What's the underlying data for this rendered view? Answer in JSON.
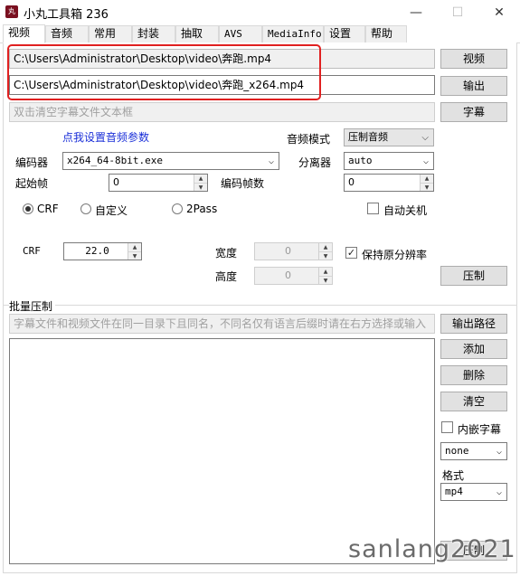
{
  "window": {
    "icon_text": "丸",
    "title": "小丸工具箱 236",
    "minimize_glyph": "—",
    "maximize_glyph": "☐",
    "close_glyph": "✕"
  },
  "tabs": [
    "视频",
    "音频",
    "常用",
    "封装",
    "抽取",
    "AVS",
    "MediaInfo",
    "设置",
    "帮助"
  ],
  "video": {
    "input_path": "C:\\Users\\Administrator\\Desktop\\video\\奔跑.mp4",
    "output_path": "C:\\Users\\Administrator\\Desktop\\video\\奔跑_x264.mp4",
    "subtitle_placeholder": "双击清空字幕文件文本框",
    "video_button": "视频",
    "output_button": "输出",
    "subtitle_button": "字幕",
    "audio_params_link": "点我设置音频参数",
    "audio_mode_label": "音频模式",
    "audio_mode_value": "压制音频",
    "encoder_label": "编码器",
    "encoder_value": "x264_64-8bit.exe",
    "demuxer_label": "分离器",
    "demuxer_value": "auto",
    "start_frame_label": "起始帧",
    "start_frame_value": "0",
    "encode_frames_label": "编码帧数",
    "encode_frames_value": "0",
    "mode_crf": "CRF",
    "mode_custom": "自定义",
    "mode_2pass": "2Pass",
    "auto_shutdown_label": "自动关机",
    "crf_label": "CRF",
    "crf_value": "22.0",
    "width_label": "宽度",
    "width_value": "0",
    "height_label": "高度",
    "height_value": "0",
    "keep_resolution_label": "保持原分辨率",
    "keep_resolution_mark": "✓",
    "encode_button": "压制"
  },
  "batch": {
    "section_label": "批量压制",
    "hint_text": "字幕文件和视频文件在同一目录下且同名，不同名仅有语言后缀时请在右方选择或输入",
    "output_path_button": "输出路径",
    "add_button": "添加",
    "delete_button": "删除",
    "clear_button": "清空",
    "embed_subtitle_label": "内嵌字幕",
    "language_value": "none",
    "format_label": "格式",
    "format_value": "mp4",
    "encode_button": "压制"
  },
  "watermark": "sanlang2021"
}
